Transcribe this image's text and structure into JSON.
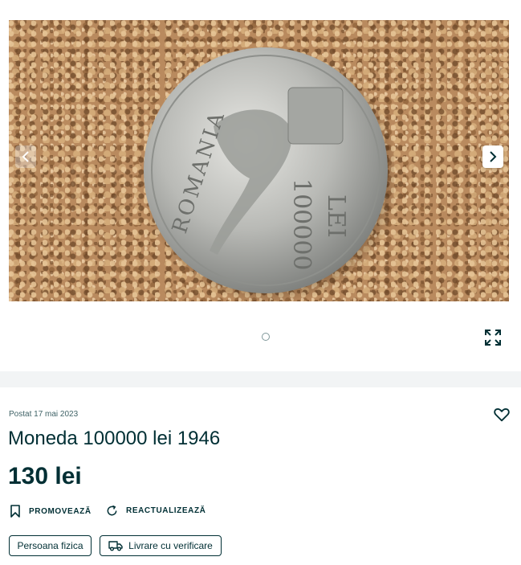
{
  "gallery": {
    "coin_legend_country": "ROMANIA",
    "coin_value": "100000",
    "coin_currency": "LEI",
    "current_image": 1,
    "image_count": 1
  },
  "listing": {
    "posted": "Postat 17 mai 2023",
    "title": "Moneda 100000 lei 1946",
    "price": "130 lei"
  },
  "actions": {
    "promote": "PROMOVEAZĂ",
    "refresh": "REACTUALIZEAZĂ"
  },
  "tags": {
    "seller_type": "Persoana fizica",
    "delivery": "Livrare cu verificare"
  },
  "icons": [
    "chevron-left-icon",
    "chevron-right-icon",
    "fullscreen-icon",
    "heart-icon",
    "bookmark-icon",
    "refresh-icon",
    "truck-icon"
  ],
  "colors": {
    "text": "#002f34",
    "divider": "#f2f4f5",
    "muted": "#406367"
  }
}
